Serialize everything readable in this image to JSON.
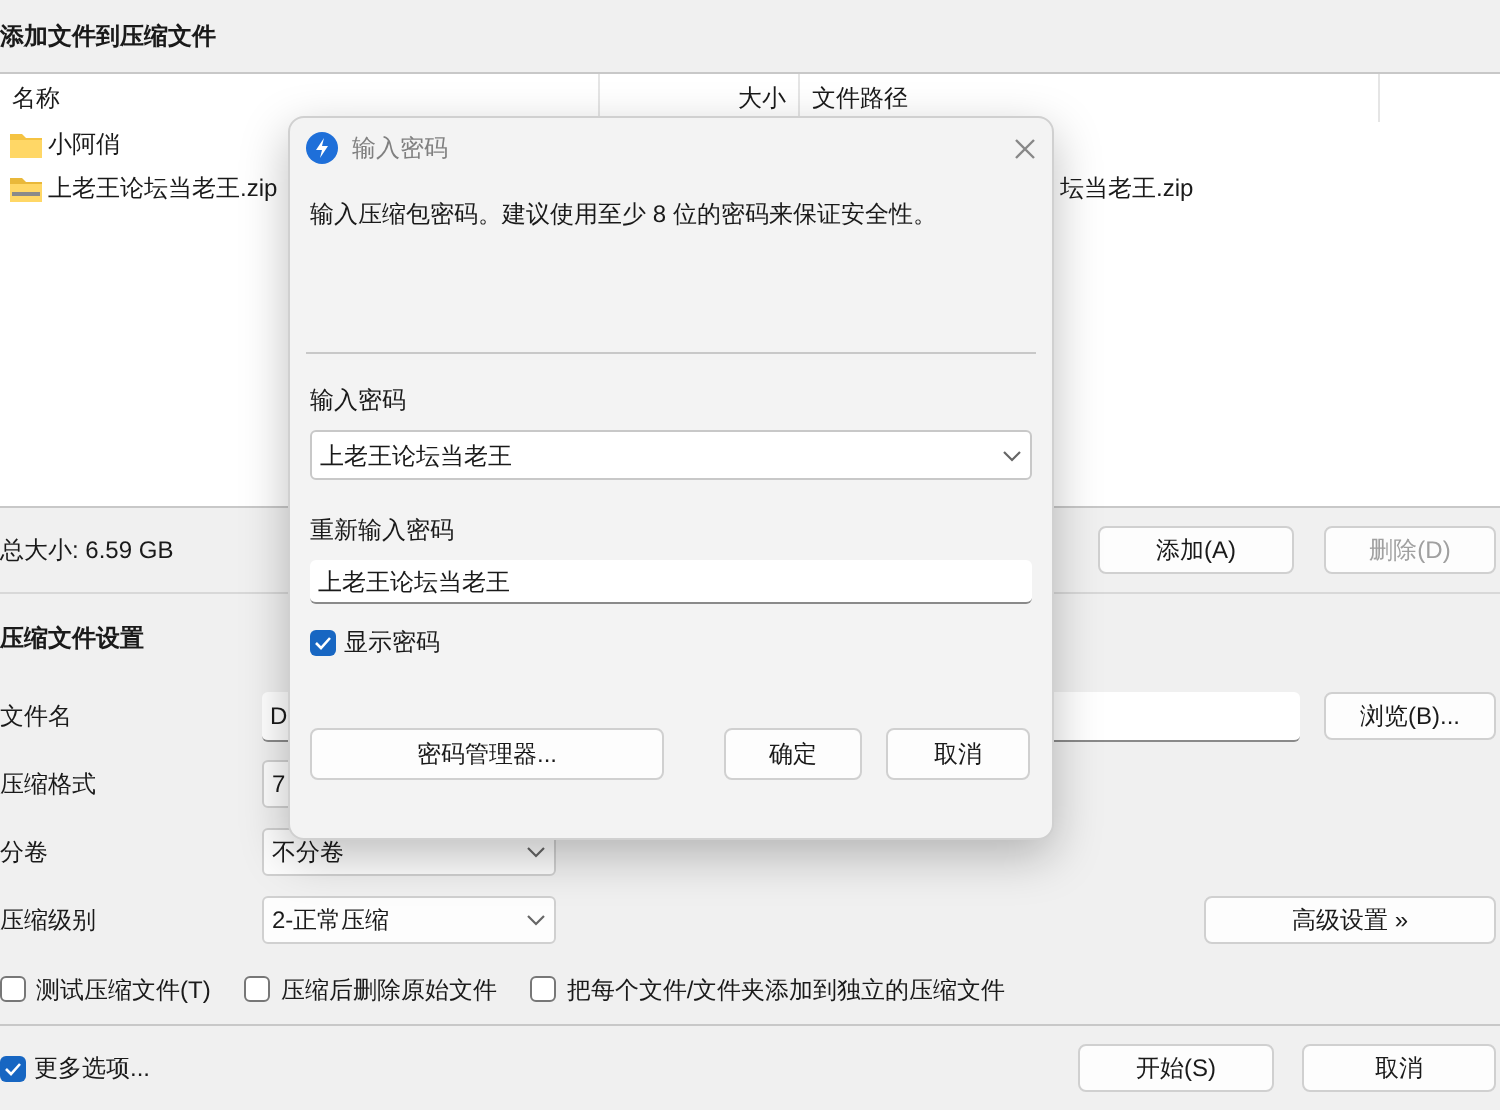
{
  "main_window": {
    "title": "添加文件到压缩文件",
    "file_list": {
      "columns": [
        "名称",
        "大小",
        "文件路径"
      ],
      "rows": [
        {
          "kind": "folder",
          "name": "小阿俏"
        },
        {
          "kind": "archive",
          "name": "上老王论坛当老王.zip",
          "path": "坛当老王.zip"
        }
      ]
    },
    "total_size": "总大小: 6.59 GB",
    "list_buttons": [
      {
        "label": "添加(A)",
        "disabled": false
      },
      {
        "label": "删除(D)",
        "disabled": true
      }
    ],
    "settings": {
      "heading": "压缩文件设置",
      "rows": [
        {
          "label": "文件名",
          "kind": "text",
          "value": "D",
          "button": "浏览(B)..."
        },
        {
          "label": "压缩格式",
          "kind": "covered",
          "value": "7"
        },
        {
          "label": "分卷",
          "kind": "select",
          "value": "不分卷"
        },
        {
          "label": "压缩级别",
          "kind": "select",
          "value": "2-正常压缩",
          "button": "高级设置 »"
        }
      ],
      "options": [
        {
          "label": "测试压缩文件(T)",
          "checked": false
        },
        {
          "label": "压缩后删除原始文件",
          "checked": false
        },
        {
          "label": "把每个文件/文件夹添加到独立的压缩文件",
          "checked": false
        }
      ]
    },
    "more_options": {
      "label": "更多选项...",
      "checked": true
    },
    "buttons": [
      "开始(S)",
      "取消"
    ]
  },
  "password_dialog": {
    "title": "输入密码",
    "message": "输入压缩包密码。建议使用至少 8 位的密码来保证安全性。",
    "password_label": "输入密码",
    "password": "上老王论坛当老王",
    "confirm_label": "重新输入密码",
    "confirm": "上老王论坛当老王",
    "show_password": {
      "label": "显示密码",
      "checked": true
    },
    "buttons": [
      "密码管理器...",
      "确定",
      "取消"
    ]
  }
}
